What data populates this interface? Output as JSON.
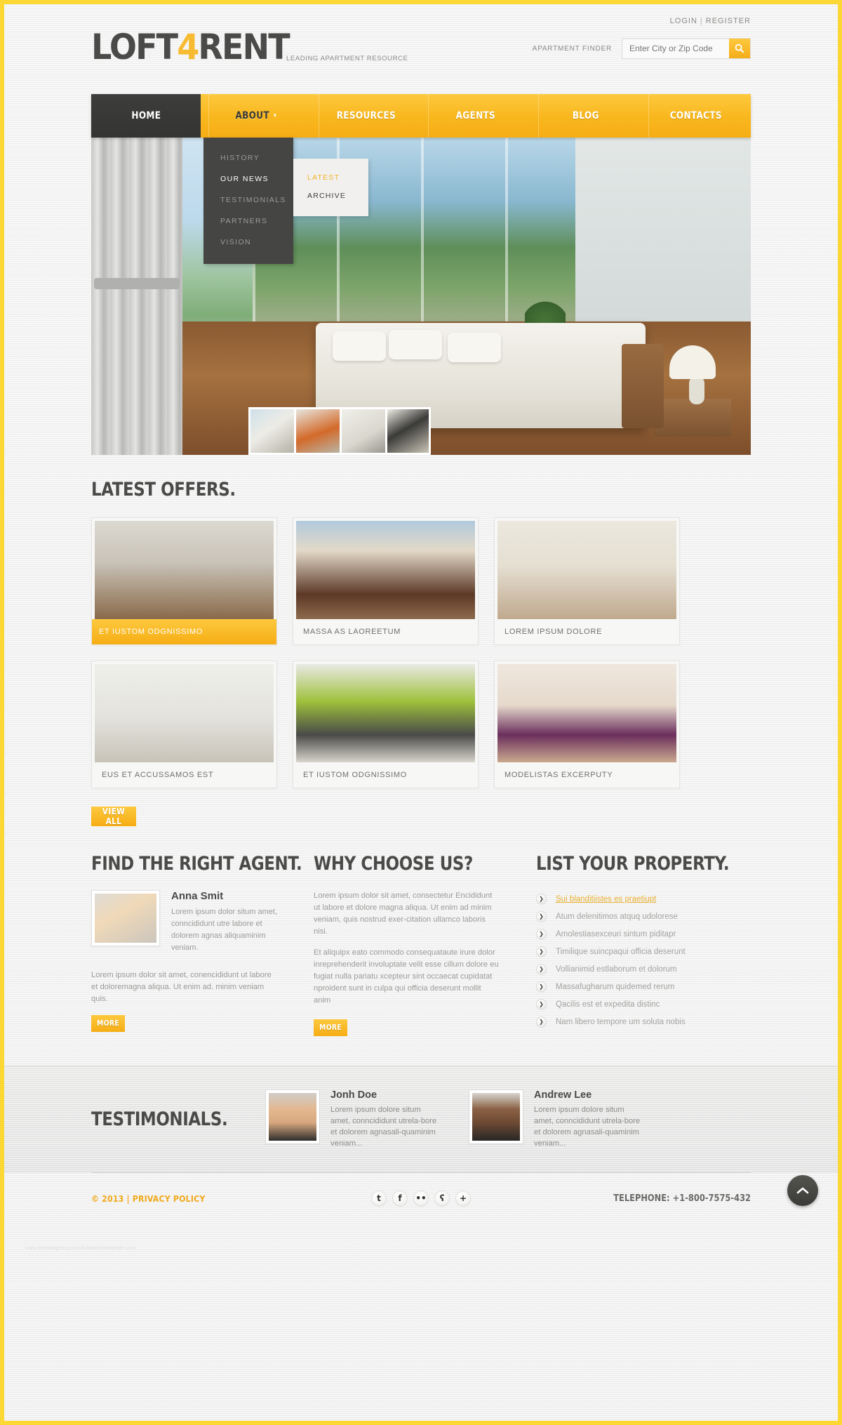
{
  "brand": {
    "name_part1": "LOFT",
    "name_accent": "4",
    "name_part2": "RENT",
    "tagline": "LEADING APARTMENT RESOURCE"
  },
  "topbar": {
    "login": "LOGIN",
    "separator": "|",
    "register": "REGISTER"
  },
  "finder": {
    "label": "APARTMENT FINDER",
    "placeholder": "Enter City or Zip Code",
    "value": "",
    "search_icon": "search-icon"
  },
  "nav": {
    "items": [
      {
        "label": "HOME",
        "state": "active"
      },
      {
        "label": "ABOUT",
        "state": "hover",
        "caret": "▾"
      },
      {
        "label": "RESOURCES",
        "state": "normal"
      },
      {
        "label": "AGENTS",
        "state": "normal"
      },
      {
        "label": "BLOG",
        "state": "normal"
      },
      {
        "label": "CONTACTS",
        "state": "normal"
      }
    ]
  },
  "dropdown": {
    "items": [
      {
        "label": "HISTORY",
        "state": "normal"
      },
      {
        "label": "OUR NEWS",
        "state": "on"
      },
      {
        "label": "TESTIMONIALS",
        "state": "normal"
      },
      {
        "label": "PARTNERS",
        "state": "normal"
      },
      {
        "label": "VISION",
        "state": "normal"
      }
    ],
    "flyout": [
      {
        "label": "LATEST",
        "state": "on"
      },
      {
        "label": "ARCHIVE",
        "state": "off"
      }
    ]
  },
  "offers": {
    "title": "LATEST OFFERS.",
    "cards": [
      {
        "caption": "ET IUSTOM ODGNISSIMO",
        "highlight": true
      },
      {
        "caption": "MASSA AS LAOREETUM",
        "highlight": false
      },
      {
        "caption": "LOREM IPSUM DOLORE",
        "highlight": false
      },
      {
        "caption": "EUS ET ACCUSSAMOS EST",
        "highlight": false
      },
      {
        "caption": "ET IUSTOM ODGNISSIMO",
        "highlight": false
      },
      {
        "caption": "MODELISTAS EXCERPUTY",
        "highlight": false
      }
    ],
    "view_all": "VIEW ALL"
  },
  "agent": {
    "title": "FIND THE RIGHT AGENT.",
    "name": "Anna Smit",
    "bio": "Lorem ipsum dolor situm amet, conncididunt utre labore et dolorem agnas aliquaminim veniam.",
    "paragraph": "Lorem ipsum dolor sit amet, conencididunt ut labore et doloremagna aliqua. Ut enim ad. minim veniam quis.",
    "more": "MORE"
  },
  "why": {
    "title": "WHY CHOOSE US?",
    "p1": "Lorem ipsum dolor sit amet, consectetur Encididunt ut labore et dolore magna aliqua. Ut enim ad minim veniam, quis nostrud exer-citation ullamco laboris nisi.",
    "p2": "Et aliquipx eato commodo consequataute irure dolor inreprehenderit involuptate velit esse cillum dolore eu fugiat nulla pariatu xcepteur sint occaecat cupidatat nproident sunt in culpa qui officia deserunt mollit anim",
    "more": "MORE"
  },
  "property": {
    "title": "LIST YOUR PROPERTY.",
    "items": [
      {
        "text": "Sui blanditiistes es praetiupt",
        "link": true
      },
      {
        "text": "Atum delenitimos atquq udolorese",
        "link": false
      },
      {
        "text": "Amolestiasexceuri sintum piditapr",
        "link": false
      },
      {
        "text": "Timilique suincpaqui officia deserunt",
        "link": false
      },
      {
        "text": "Vollianimid estlaborum et dolorum",
        "link": false
      },
      {
        "text": "Massafugharum quidemed rerum",
        "link": false
      },
      {
        "text": "Qacilis est et expedita distinc",
        "link": false
      },
      {
        "text": "Nam libero tempore um soluta nobis",
        "link": false
      }
    ],
    "bullet_icon": "chevron-right-icon"
  },
  "testimonials": {
    "title": "TESTIMONIALS.",
    "items": [
      {
        "name": "Jonh Doe",
        "text": "Lorem ipsum dolore situm amet, conncididunt utrela-bore et dolorem agnasali-quaminim veniam..."
      },
      {
        "name": "Andrew Lee",
        "text": "Lorem ipsum dolore situm amet, conncididunt utrela-bore et dolorem agnasali-quaminim veniam..."
      }
    ]
  },
  "footer": {
    "copyright": "© 2013 | PRIVACY POLICY",
    "socials": [
      {
        "name": "twitter-icon",
        "glyph": "t"
      },
      {
        "name": "facebook-icon",
        "glyph": "f"
      },
      {
        "name": "flickr-icon",
        "glyph": "••"
      },
      {
        "name": "rss-icon",
        "glyph": "ʕ"
      },
      {
        "name": "googleplus-icon",
        "glyph": "+"
      }
    ],
    "phone": "TELEPHONE: +1-800-7575-432",
    "credit": "www.themeagency.com/loft4rent/template.com"
  },
  "scroll_top": {
    "icon": "chevron-up-icon"
  },
  "colors": {
    "accent": "#f6ad14",
    "accent_light": "#fdc93f",
    "dark": "#3d3d3b",
    "page_border": "#fdd835"
  }
}
